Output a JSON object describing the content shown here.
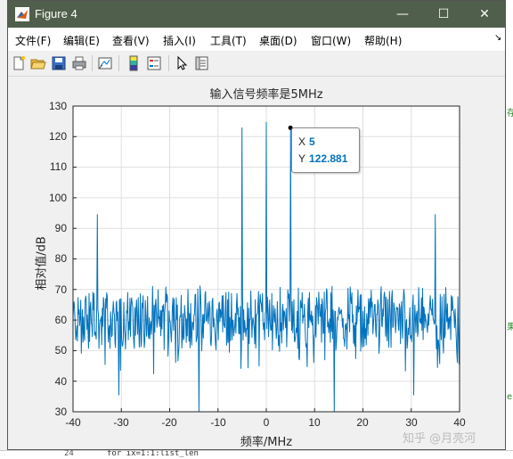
{
  "window": {
    "title": "Figure 4",
    "minimize_glyph": "—",
    "maximize_glyph": "☐",
    "close_glyph": "✕"
  },
  "menu": [
    {
      "label": "文件(F)"
    },
    {
      "label": "编辑(E)"
    },
    {
      "label": "查看(V)"
    },
    {
      "label": "插入(I)"
    },
    {
      "label": "工具(T)"
    },
    {
      "label": "桌面(D)"
    },
    {
      "label": "窗口(W)"
    },
    {
      "label": "帮助(H)"
    }
  ],
  "toolbar_icons": [
    "new-figure-icon",
    "open-file-icon",
    "save-icon",
    "print-icon",
    "link-plot-icon",
    "insert-colorbar-icon",
    "insert-legend-icon",
    "pointer-icon",
    "property-inspector-icon"
  ],
  "datatip": {
    "x_label": "X",
    "x_value": "5",
    "y_label": "Y",
    "y_value": "122.881"
  },
  "background": {
    "line_number": "24",
    "code_fragment": "for ix=1:1:list_len",
    "right_fragments": [
      "存",
      "果",
      "e"
    ]
  },
  "watermark": "知乎 @月亮河",
  "colors": {
    "line": "#0072bd",
    "titlebar": "#505f4b",
    "grid": "#dfdfdf"
  },
  "chart_data": {
    "type": "line",
    "title": "输入信号频率是5MHz",
    "xlabel": "频率/MHz",
    "ylabel": "相对值/dB",
    "xlim": [
      -40,
      40
    ],
    "ylim": [
      30,
      130
    ],
    "xticks": [
      "-40",
      "-30",
      "-20",
      "-10",
      "0",
      "10",
      "20",
      "30",
      "40"
    ],
    "yticks": [
      "30",
      "40",
      "50",
      "60",
      "70",
      "80",
      "90",
      "100",
      "110",
      "120",
      "130"
    ],
    "grid": true,
    "noise_floor_mean": 60,
    "peaks": [
      {
        "x": -35,
        "y": 94.5
      },
      {
        "x": -5,
        "y": 122.9
      },
      {
        "x": 0,
        "y": 124.7
      },
      {
        "x": 5,
        "y": 122.881
      },
      {
        "x": 35,
        "y": 94.5
      }
    ],
    "dips": [
      {
        "x": -30.5,
        "y": 35.5
      },
      {
        "x": -14,
        "y": 30
      },
      {
        "x": 14,
        "y": 30
      },
      {
        "x": 30.5,
        "y": 35.5
      }
    ],
    "marker": {
      "x": 5,
      "y": 122.881
    }
  }
}
